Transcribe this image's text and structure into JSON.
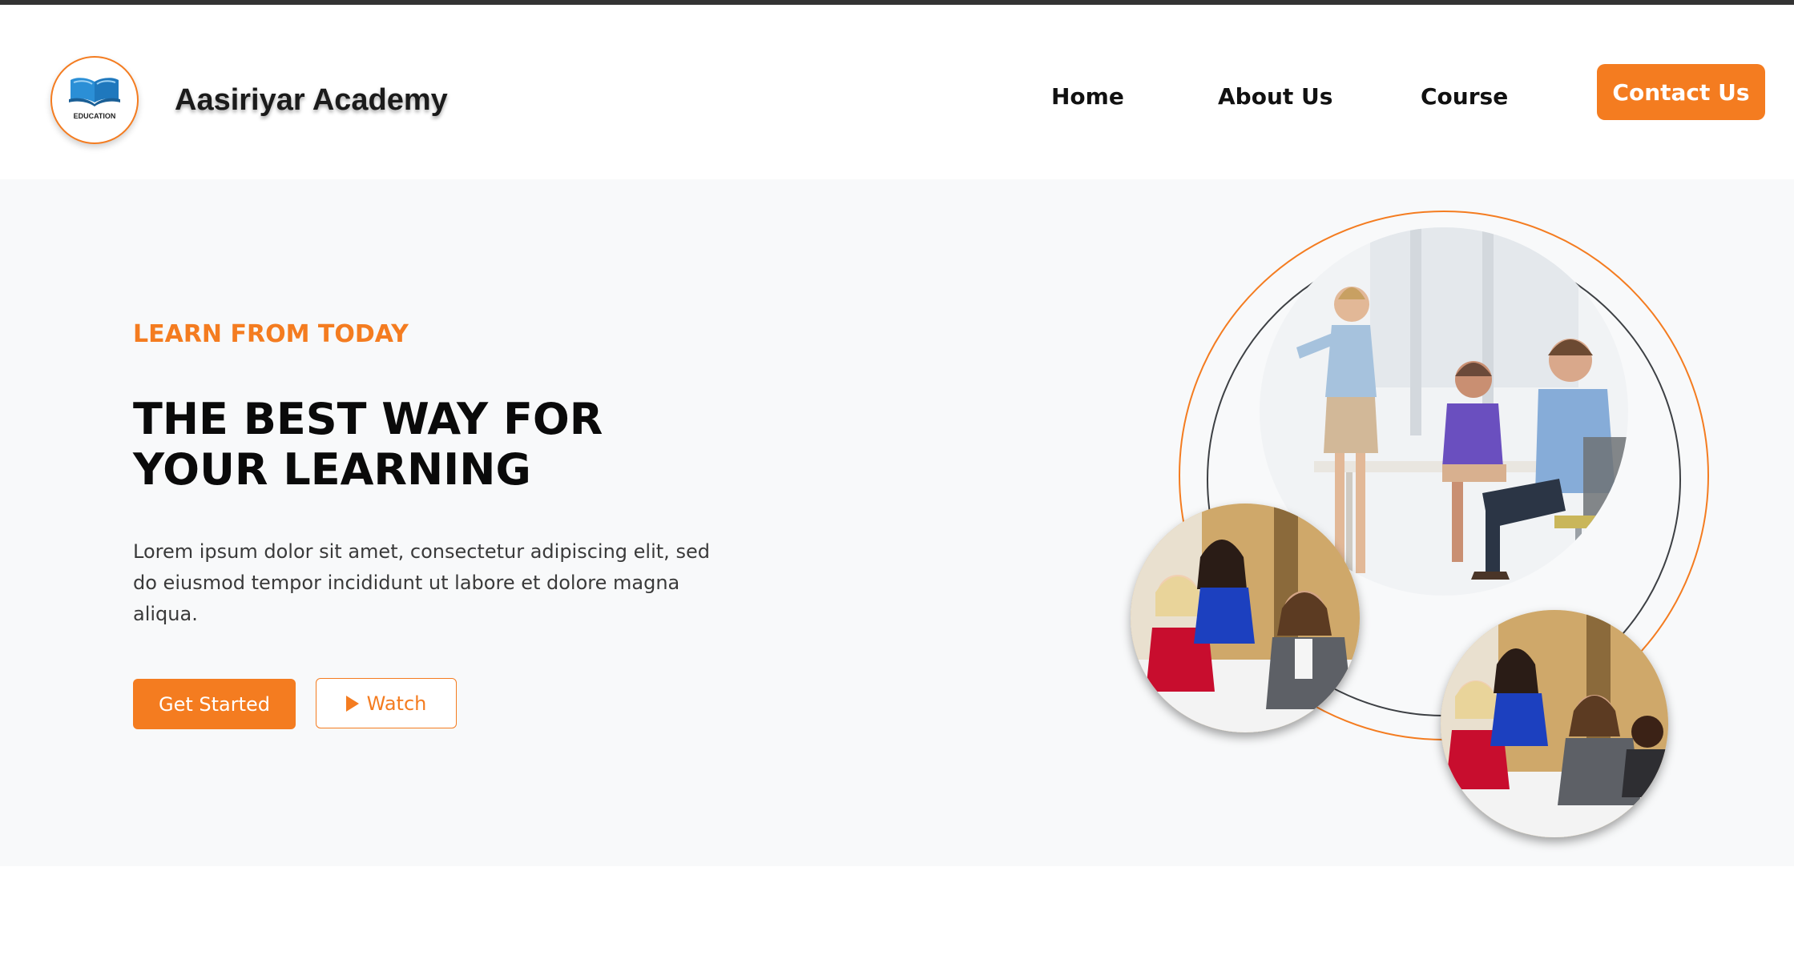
{
  "brand": {
    "name": "Aasiriyar Academy",
    "logo_caption": "EDUCATION",
    "logo_icon": "open-book-icon"
  },
  "nav": {
    "items": [
      {
        "label": "Home"
      },
      {
        "label": "About Us"
      },
      {
        "label": "Course"
      }
    ],
    "contact_label": "Contact Us"
  },
  "hero": {
    "eyebrow": "LEARN FROM TODAY",
    "headline_line1": "THE BEST WAY FOR",
    "headline_line2": "YOUR LEARNING",
    "description": "Lorem ipsum dolor sit amet, consectetur adipiscing elit, sed do eiusmod tempor incididunt ut labore et dolore magna aliqua.",
    "primary_button": "Get Started",
    "secondary_button": "Watch",
    "secondary_icon": "play-icon"
  },
  "colors": {
    "accent": "#f47c20",
    "dark": "#0a0a0a",
    "hero_bg": "#f8f9fa",
    "ring_dark": "#3d4044"
  }
}
